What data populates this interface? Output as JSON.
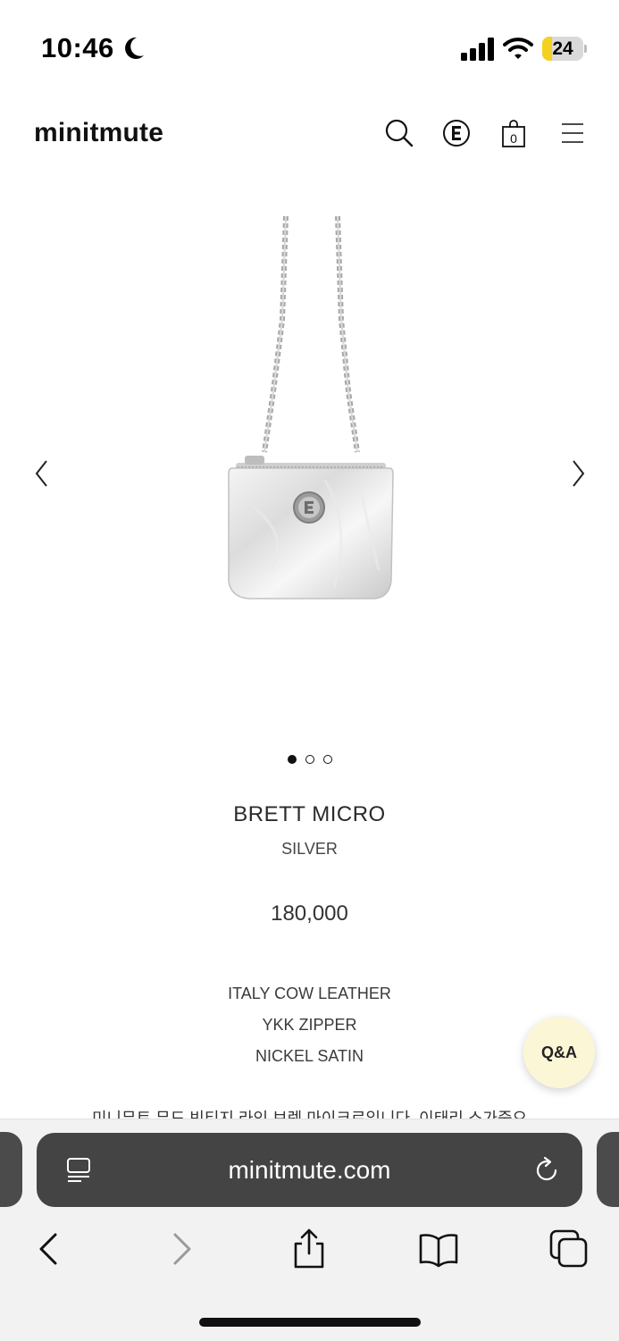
{
  "status_bar": {
    "time": "10:46",
    "battery_level": "24",
    "battery_color": "#f5d020",
    "icons": [
      "moon-icon",
      "signal-icon",
      "wifi-icon",
      "battery-icon"
    ]
  },
  "header": {
    "logo": "minitmute",
    "cart_count": "0",
    "icons": [
      "search-icon",
      "e-logo-icon",
      "shopping-bag-icon",
      "hamburger-menu-icon"
    ]
  },
  "gallery": {
    "slide_count": 3,
    "active_slide": 1,
    "icons": [
      "chevron-left-icon",
      "chevron-right-icon"
    ]
  },
  "product": {
    "name": "BRETT MICRO",
    "color": "SILVER",
    "price": "180,000",
    "specs": [
      "ITALY COW LEATHER",
      "YKK ZIPPER",
      "NICKEL SATIN"
    ],
    "description": "미니뮤트 무드 빈티지 라인 브렛 마이크로입니다. 이태리 소가죽으"
  },
  "qa_button": {
    "label": "Q&A"
  },
  "browser": {
    "url": "minitmute.com",
    "address_bar_color": "#444444",
    "icons": [
      "reader-mode-icon",
      "reload-icon",
      "back-icon",
      "forward-icon",
      "share-icon",
      "bookmarks-icon",
      "tabs-icon"
    ]
  }
}
